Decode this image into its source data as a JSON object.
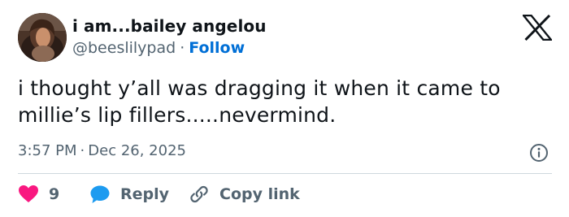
{
  "author": {
    "display_name": "i am...bailey angelou",
    "handle": "@beeslilypad",
    "separator": "·",
    "follow_label": "Follow",
    "avatar_icon": "profile-photo"
  },
  "platform_icon": "x-logo-icon",
  "tweet": {
    "text_line1": "i thought y’all was dragging it when it came to",
    "text_line2": "millie’s lip fillers.....nevermind."
  },
  "meta": {
    "time": "3:57 PM",
    "separator": "·",
    "date": "Dec 26, 2025",
    "info_icon": "info-icon"
  },
  "actions": {
    "like_count": "9",
    "reply_label": "Reply",
    "copy_link_label": "Copy link"
  },
  "colors": {
    "like": "#f91880",
    "reply": "#1d9bf0",
    "follow": "#006fd6",
    "muted": "#536471",
    "divider": "#cfd9de"
  }
}
